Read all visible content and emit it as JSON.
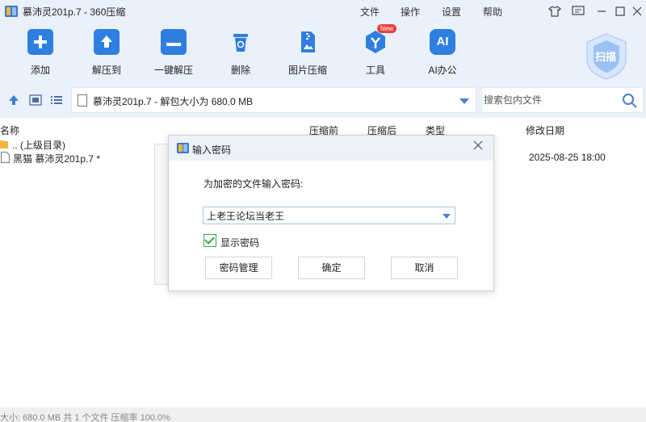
{
  "window": {
    "title": "慕沛灵201p.7 - 360压缩",
    "menu": [
      "文件",
      "操作",
      "设置",
      "帮助"
    ]
  },
  "toolbar": {
    "items": [
      {
        "label": "添加",
        "icon": "add-icon"
      },
      {
        "label": "解压到",
        "icon": "extract-to-icon"
      },
      {
        "label": "一键解压",
        "icon": "one-click-extract-icon"
      },
      {
        "label": "删除",
        "icon": "delete-icon"
      },
      {
        "label": "图片压缩",
        "icon": "image-compress-icon"
      },
      {
        "label": "工具",
        "icon": "tools-icon",
        "badge": "New"
      },
      {
        "label": "AI办公",
        "icon": "ai-office-icon",
        "icon_text": "AI"
      }
    ],
    "scan_label": "扫描"
  },
  "address": {
    "path": "慕沛灵201p.7 - 解包大小为 680.0 MB",
    "search_placeholder": "搜索包内文件"
  },
  "list": {
    "headers": {
      "name": "名称",
      "compressed_before": "压缩前",
      "compressed_after": "压缩后",
      "type": "类型",
      "modified": "修改日期"
    },
    "rows": [
      {
        "name": ".. (上级目录)",
        "modified": ""
      },
      {
        "name": "黑猫 慕沛灵201p.7 *",
        "modified": "2025-08-25 18:00"
      }
    ]
  },
  "status": {
    "text": "大小: 680.0 MB 共 1 个文件 压缩率 100.0%"
  },
  "dialog": {
    "title": "输入密码",
    "prompt": "为加密的文件输入密码:",
    "password_value": "上老王论坛当老王",
    "show_password_label": "显示密码",
    "show_password_checked": true,
    "buttons": {
      "manage": "密码管理",
      "ok": "确定",
      "cancel": "取消"
    }
  },
  "colors": {
    "accent": "#2d7be5",
    "toolbar_bg": "#eaf1fb",
    "badge_red": "#e8413c",
    "checkbox_green": "#3aa55a"
  }
}
